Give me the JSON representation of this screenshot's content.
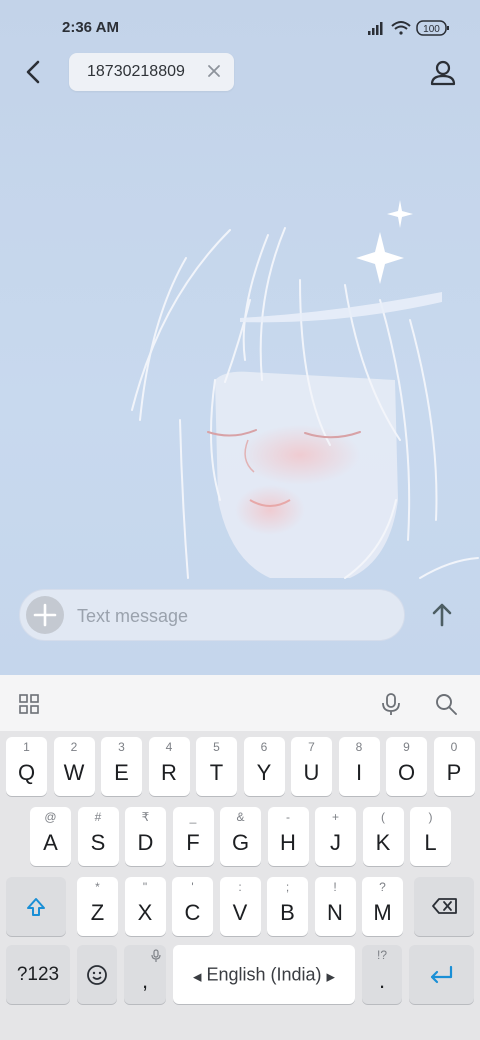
{
  "status_bar": {
    "time": "2:36 AM",
    "battery": "100"
  },
  "header": {
    "recipient": "18730218809"
  },
  "composer": {
    "placeholder": "Text message"
  },
  "keyboard": {
    "rows": [
      [
        {
          "k": "Q",
          "h": "1"
        },
        {
          "k": "W",
          "h": "2"
        },
        {
          "k": "E",
          "h": "3"
        },
        {
          "k": "R",
          "h": "4"
        },
        {
          "k": "T",
          "h": "5"
        },
        {
          "k": "Y",
          "h": "6"
        },
        {
          "k": "U",
          "h": "7"
        },
        {
          "k": "I",
          "h": "8"
        },
        {
          "k": "O",
          "h": "9"
        },
        {
          "k": "P",
          "h": "0"
        }
      ],
      [
        {
          "k": "A",
          "h": "@"
        },
        {
          "k": "S",
          "h": "#"
        },
        {
          "k": "D",
          "h": "₹"
        },
        {
          "k": "F",
          "h": "_"
        },
        {
          "k": "G",
          "h": "&"
        },
        {
          "k": "H",
          "h": "-"
        },
        {
          "k": "J",
          "h": "+"
        },
        {
          "k": "K",
          "h": "("
        },
        {
          "k": "L",
          "h": ")"
        }
      ],
      [
        {
          "k": "Z",
          "h": "*"
        },
        {
          "k": "X",
          "h": "\""
        },
        {
          "k": "C",
          "h": "'"
        },
        {
          "k": "V",
          "h": ":"
        },
        {
          "k": "B",
          "h": ";"
        },
        {
          "k": "N",
          "h": "!"
        },
        {
          "k": "M",
          "h": "?"
        }
      ]
    ],
    "symbols_label": "?123",
    "comma_label": ",",
    "space_label": "English (India)",
    "period_label": ".",
    "period_hint": "!?",
    "accent_color": "#1a8fd6"
  },
  "icons": [
    "back-arrow-icon",
    "close-icon",
    "contact-icon",
    "plus-icon",
    "send-icon",
    "grid-icon",
    "mic-icon",
    "search-icon",
    "shift-icon",
    "backspace-icon",
    "emoji-icon",
    "enter-icon",
    "signal-icon",
    "wifi-icon",
    "battery-icon"
  ]
}
